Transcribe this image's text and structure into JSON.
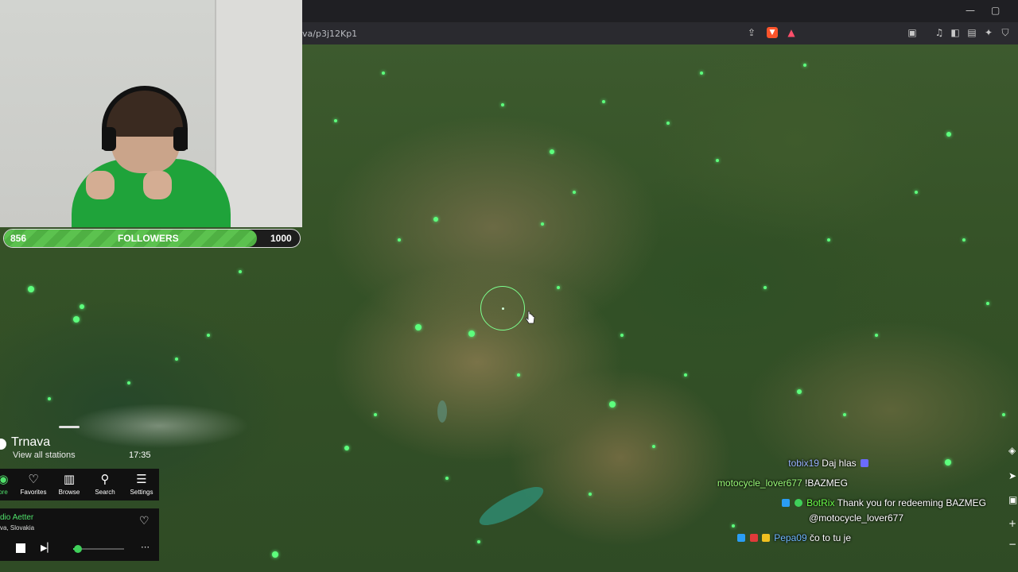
{
  "browser": {
    "url": "va/p3j12Kp1",
    "window_controls": [
      "—",
      "▢"
    ],
    "toolbar_icons": [
      "share-icon",
      "brave-shield-icon",
      "rewards-icon",
      "reader-icon",
      "music-icon",
      "sidebar-icon",
      "wallet-icon",
      "extensions-icon",
      "vpn-icon"
    ]
  },
  "stream_overlay": {
    "followers": {
      "current": "856",
      "label": "FOLLOWERS",
      "goal": "1000",
      "progress_fraction": 0.856
    }
  },
  "radio": {
    "place_name": "Trnava",
    "view_all": "View all stations",
    "time": "17:35",
    "nav": [
      {
        "label": "ore",
        "icon": "explore-icon"
      },
      {
        "label": "Favorites",
        "icon": "heart-icon"
      },
      {
        "label": "Browse",
        "icon": "map-icon"
      },
      {
        "label": "Search",
        "icon": "search-icon"
      },
      {
        "label": "Settings",
        "icon": "menu-icon"
      }
    ],
    "player": {
      "station": "dio Aetter",
      "location": "va, Slovakia",
      "volume_fraction": 0.1
    }
  },
  "chat": [
    {
      "user": "tobix19",
      "message": "Daj hlas",
      "user_color": "#9ab4ff"
    },
    {
      "user": "motocycle_lover677",
      "message": "!BAZMEG",
      "user_color": "#9dff7a"
    },
    {
      "user": "BotRix",
      "message": "Thank you for redeeming BAZMEG",
      "message2": "@motocycle_lover677",
      "user_color": "#6cff4a"
    },
    {
      "user": "Pepa09",
      "message": "čo to tu je",
      "user_color": "#6fb7ff"
    }
  ],
  "colors": {
    "station_dot": "#5dff7d",
    "accent_green": "#4fe06a"
  }
}
